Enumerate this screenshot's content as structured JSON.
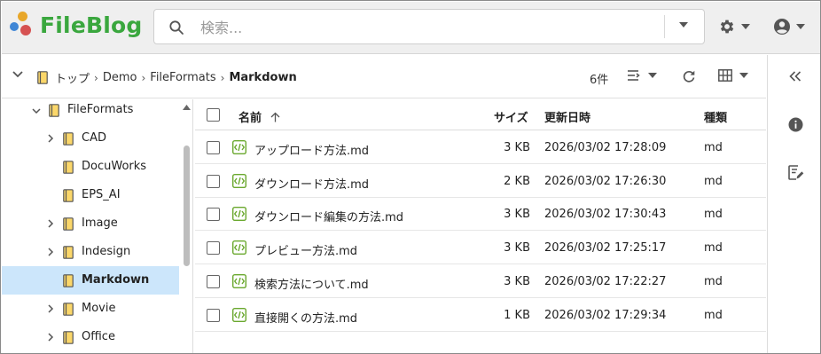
{
  "app": {
    "name": "FileBlog",
    "brand_color": "#3aa73e"
  },
  "search": {
    "placeholder": "検索...",
    "value": ""
  },
  "breadcrumb": {
    "items": [
      "トップ",
      "Demo",
      "FileFormats",
      "Markdown"
    ]
  },
  "toolbar": {
    "count": "6件"
  },
  "tree": {
    "items": [
      {
        "label": "FileFormats",
        "expanded": true,
        "has_children": true
      },
      {
        "label": "CAD",
        "has_children": true
      },
      {
        "label": "DocuWorks",
        "has_children": false
      },
      {
        "label": "EPS_AI",
        "has_children": false
      },
      {
        "label": "Image",
        "has_children": true
      },
      {
        "label": "Indesign",
        "has_children": true
      },
      {
        "label": "Markdown",
        "has_children": false,
        "selected": true
      },
      {
        "label": "Movie",
        "has_children": true
      },
      {
        "label": "Office",
        "has_children": true
      }
    ]
  },
  "table": {
    "columns": {
      "name": "名前",
      "size": "サイズ",
      "modified": "更新日時",
      "type": "種類"
    },
    "sort": {
      "column": "name",
      "direction": "asc"
    },
    "rows": [
      {
        "name": "アップロード方法.md",
        "size": "3 KB",
        "modified": "2026/03/02 17:28:09",
        "type": "md"
      },
      {
        "name": "ダウンロード方法.md",
        "size": "2 KB",
        "modified": "2026/03/02 17:26:30",
        "type": "md"
      },
      {
        "name": "ダウンロード編集の方法.md",
        "size": "3 KB",
        "modified": "2026/03/02 17:30:43",
        "type": "md"
      },
      {
        "name": "プレビュー方法.md",
        "size": "3 KB",
        "modified": "2026/03/02 17:25:17",
        "type": "md"
      },
      {
        "name": "検索方法について.md",
        "size": "3 KB",
        "modified": "2026/03/02 17:22:27",
        "type": "md"
      },
      {
        "name": "直接開くの方法.md",
        "size": "1 KB",
        "modified": "2026/03/02 17:29:34",
        "type": "md"
      }
    ]
  },
  "icons": {
    "logo": "fileblog-logo-icon",
    "search": "search-icon",
    "settings": "gear-icon",
    "account": "user-circle-icon",
    "folder": "folder-icon",
    "markdown_file": "markdown-file-icon",
    "refresh": "refresh-icon",
    "list_view": "list-view-icon",
    "grid_view": "grid-view-icon",
    "collapse_panel": "double-chevron-left-icon",
    "info": "info-icon",
    "edit_note": "edit-note-icon"
  }
}
